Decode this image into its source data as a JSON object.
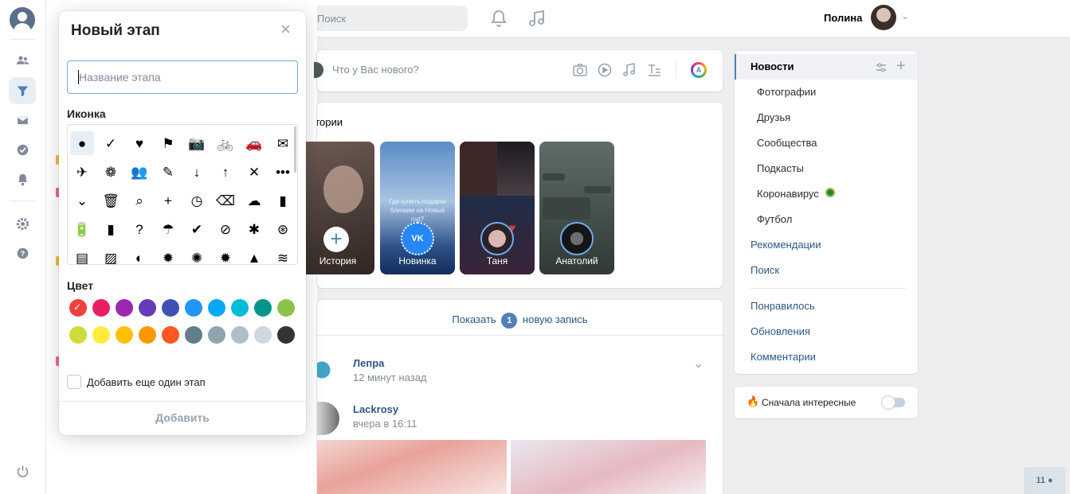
{
  "topbar": {
    "search_placeholder": "Поиск",
    "user_name": "Полина"
  },
  "post_new": {
    "placeholder": "Что у Вас нового?"
  },
  "stories": {
    "title": "Истории",
    "items": [
      {
        "label": "История",
        "bg": "#4b3f3a"
      },
      {
        "label": "Новинка",
        "bg": "#3e6aa5",
        "text": "Где купить подарки близким на Новый год?"
      },
      {
        "label": "Таня",
        "bg": "#2a2530"
      },
      {
        "label": "Анатолий",
        "bg": "#4b5a55"
      }
    ]
  },
  "feed": {
    "show_prefix": "Показать",
    "show_count": "1",
    "show_suffix": "новую запись",
    "posts": [
      {
        "author": "Лепра",
        "time": "12 минут назад"
      },
      {
        "author": "Lackrosy",
        "time": "вчера в 16:11"
      }
    ]
  },
  "right_menu": {
    "items": [
      {
        "label": "Новости",
        "type": "sel"
      },
      {
        "label": "Фотографии",
        "type": "sub"
      },
      {
        "label": "Друзья",
        "type": "sub"
      },
      {
        "label": "Сообщества",
        "type": "sub"
      },
      {
        "label": "Подкасты",
        "type": "sub"
      },
      {
        "label": "Коронавирус",
        "type": "sub"
      },
      {
        "label": "Футбол",
        "type": "sub"
      },
      {
        "label": "Рекомендации",
        "type": "main"
      },
      {
        "label": "Поиск",
        "type": "main"
      },
      {
        "label": "Понравилось",
        "type": "main"
      },
      {
        "label": "Обновления",
        "type": "main"
      },
      {
        "label": "Комментарии",
        "type": "main"
      }
    ]
  },
  "interest": {
    "label": "Сначала интересные",
    "on": false
  },
  "counter": {
    "value": "11"
  },
  "popup": {
    "title": "Новый этап",
    "name_placeholder": "Название этапа",
    "icon_label": "Иконка",
    "color_label": "Цвет",
    "icons": [
      [
        "●",
        "✓",
        "♥",
        "⚑",
        "📷",
        "🚲",
        "🚗",
        "✉"
      ],
      [
        "✈",
        "❁",
        "👥",
        "✎",
        "↓",
        "↑",
        "✕",
        "•••"
      ],
      [
        "⌄",
        "🗑",
        "⌕",
        "+",
        "◷",
        "⌫",
        "☁",
        "▮"
      ],
      [
        "🔋",
        "▮",
        "?",
        "☂",
        "✔",
        "⊘",
        "✱",
        "⊛"
      ],
      [
        "▤",
        "▨",
        "◐",
        "✹",
        "✺",
        "✹",
        "▲",
        "≋"
      ]
    ],
    "colors": [
      [
        "#f0413c",
        "#e91e63",
        "#9c27b0",
        "#673ab7",
        "#3f51b5",
        "#2196f3",
        "#03a9f4",
        "#00bcd4",
        "#009688",
        "#8bc34a"
      ],
      [
        "#cddc39",
        "#ffeb3b",
        "#ffc107",
        "#ff9800",
        "#ff5722",
        "#607d8b",
        "#90a4ae",
        "#b0bec5",
        "#cfd8dc",
        "#333333"
      ]
    ],
    "selected_color": "#f0413c",
    "add_another_label": "Добавить еще один этап",
    "add_button": "Добавить"
  }
}
